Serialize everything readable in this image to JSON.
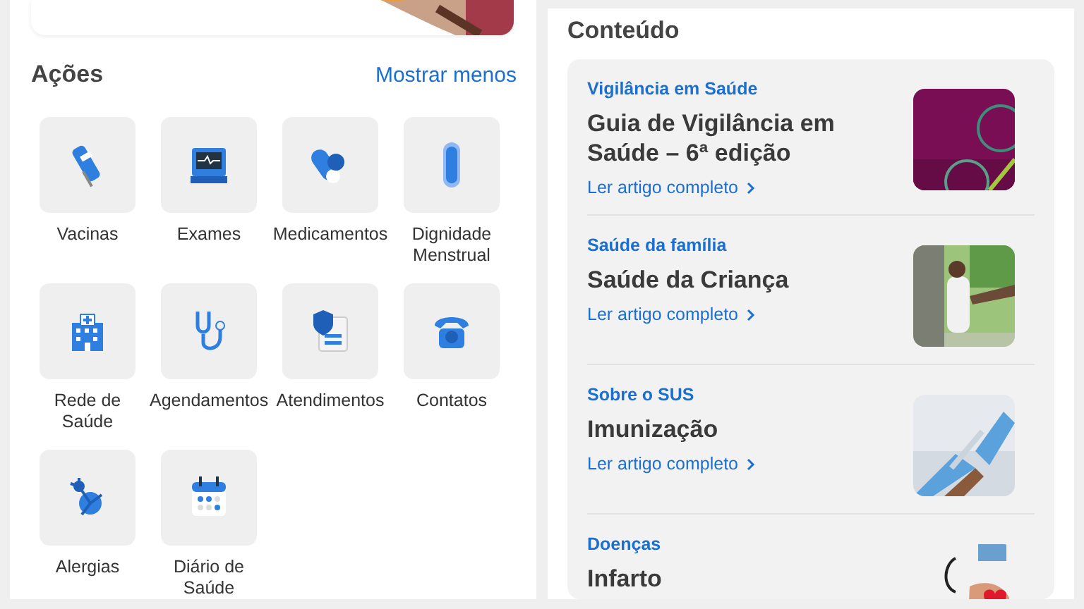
{
  "actions": {
    "title": "Ações",
    "toggle": "Mostrar menos",
    "items": [
      {
        "label": "Vacinas"
      },
      {
        "label": "Exames"
      },
      {
        "label": "Medicamentos"
      },
      {
        "label": "Dignidade Menstrual"
      },
      {
        "label": "Rede de Saúde"
      },
      {
        "label": "Agendamentos"
      },
      {
        "label": "Atendimentos"
      },
      {
        "label": "Contatos"
      },
      {
        "label": "Alergias"
      },
      {
        "label": "Diário de Saúde"
      }
    ]
  },
  "content": {
    "title": "Conteúdo",
    "articles": [
      {
        "category": "Vigilância em Saúde",
        "title": "Guia de Vigilância em Saúde – 6ª edição",
        "link": "Ler artigo completo",
        "kind": "picture"
      },
      {
        "category": "Saúde da família",
        "title": "Saúde da Criança",
        "link": "Ler artigo completo",
        "kind": "picture"
      },
      {
        "category": "Sobre o SUS",
        "title": "Imunização",
        "link": "Ler artigo completo",
        "kind": "picture"
      },
      {
        "category": "Doenças",
        "title": "Infarto",
        "kind": "picture"
      }
    ]
  }
}
